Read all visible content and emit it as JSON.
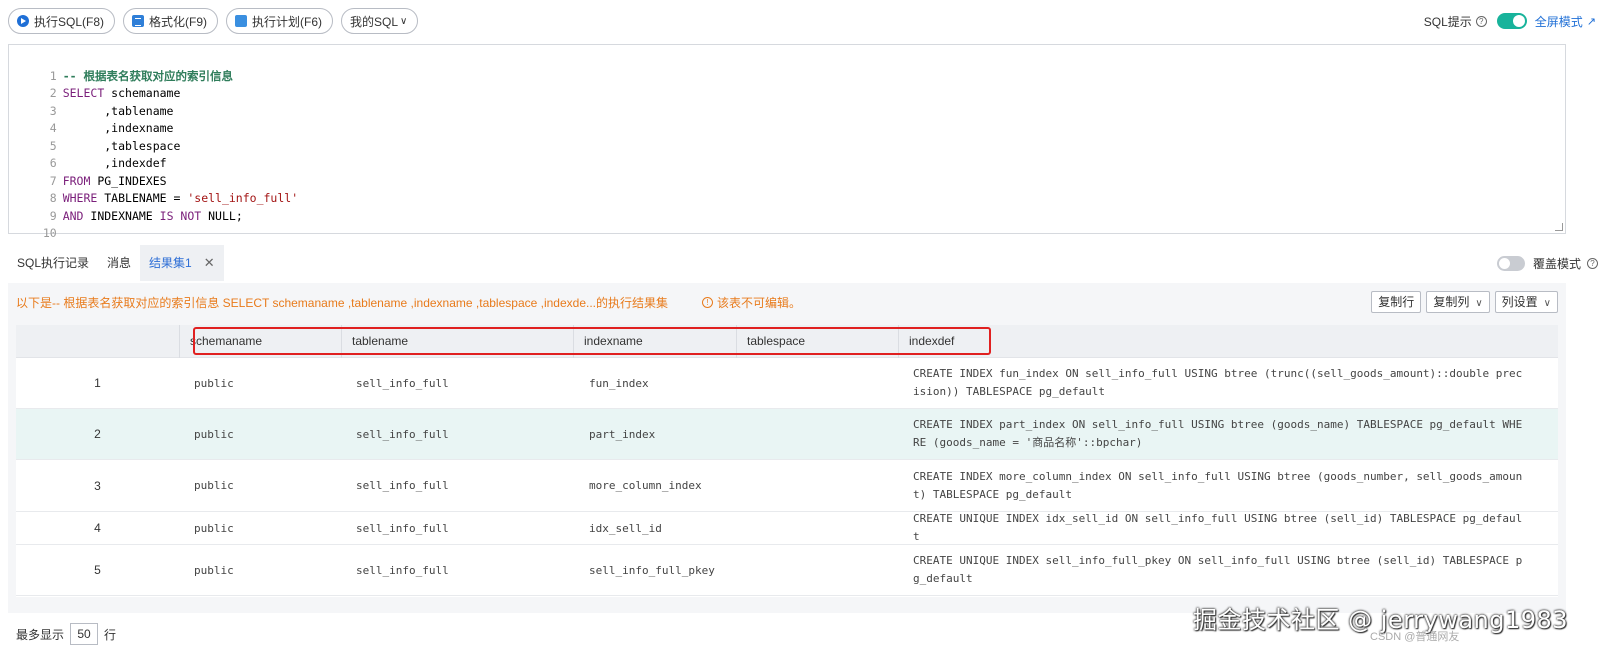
{
  "toolbar": {
    "run_label": "执行SQL(F8)",
    "format_label": "格式化(F9)",
    "plan_label": "执行计划(F6)",
    "mysql_label": "我的SQL",
    "sql_hint_label": "SQL提示",
    "sql_hint_enabled": true,
    "fullscreen_label": "全屏模式"
  },
  "editor": {
    "lines": [
      {
        "num": "1",
        "text": "-- 根据表名获取对应的索引信息"
      },
      {
        "num": "2",
        "kw": "SELECT",
        "text": " schemaname"
      },
      {
        "num": "3",
        "text": "      ,tablename"
      },
      {
        "num": "4",
        "text": "      ,indexname"
      },
      {
        "num": "5",
        "text": "      ,tablespace"
      },
      {
        "num": "6",
        "text": "      ,indexdef"
      },
      {
        "num": "7",
        "kw": "FROM",
        "text": " PG_INDEXES"
      },
      {
        "num": "8",
        "kw": "WHERE",
        "text": " TABLENAME = ",
        "str": "'sell_info_full'"
      },
      {
        "num": "9",
        "kw": "AND",
        "text": " INDEXNAME ",
        "kw2": "IS NOT",
        "text2": " NULL;"
      },
      {
        "num": "10",
        "text": ""
      }
    ]
  },
  "result_tabs": {
    "tabs": [
      "SQL执行记录",
      "消息",
      "结果集1"
    ],
    "overlay_label": "覆盖模式",
    "overlay_enabled": false
  },
  "result": {
    "info_text": "以下是-- 根据表名获取对应的索引信息 SELECT schemaname ,tablename ,indexname ,tablespace ,indexde...的执行结果集",
    "readonly_text": "该表不可编辑。",
    "copy_row_label": "复制行",
    "copy_col_label": "复制列",
    "col_settings_label": "列设置",
    "columns": [
      "schemaname",
      "tablename",
      "indexname",
      "tablespace",
      "indexdef"
    ],
    "rows": [
      {
        "n": "1",
        "schemaname": "public",
        "tablename": "sell_info_full",
        "indexname": "fun_index",
        "tablespace": "",
        "indexdef": "CREATE INDEX fun_index ON sell_info_full USING btree (trunc((sell_goods_amount)::double precision)) TABLESPACE pg_default"
      },
      {
        "n": "2",
        "schemaname": "public",
        "tablename": "sell_info_full",
        "indexname": "part_index",
        "tablespace": "",
        "indexdef": "CREATE INDEX part_index ON sell_info_full USING btree (goods_name) TABLESPACE pg_default WHERE (goods_name = '商品名称'::bpchar)"
      },
      {
        "n": "3",
        "schemaname": "public",
        "tablename": "sell_info_full",
        "indexname": "more_column_index",
        "tablespace": "",
        "indexdef": "CREATE INDEX more_column_index ON sell_info_full USING btree (goods_number, sell_goods_amount) TABLESPACE pg_default"
      },
      {
        "n": "4",
        "schemaname": "public",
        "tablename": "sell_info_full",
        "indexname": "idx_sell_id",
        "tablespace": "",
        "indexdef": "CREATE UNIQUE INDEX idx_sell_id ON sell_info_full USING btree (sell_id) TABLESPACE pg_default"
      },
      {
        "n": "5",
        "schemaname": "public",
        "tablename": "sell_info_full",
        "indexname": "sell_info_full_pkey",
        "tablespace": "",
        "indexdef": "CREATE UNIQUE INDEX sell_info_full_pkey ON sell_info_full USING btree (sell_id) TABLESPACE pg_default"
      }
    ]
  },
  "footer": {
    "prefix": "最多显示",
    "max_rows": "50",
    "suffix": "行"
  },
  "watermark": {
    "main": "掘金技术社区 @ jerrywang1983",
    "sub": "CSDN @普通网友"
  },
  "colors": {
    "accent": "#1f6fd6",
    "switch_on": "#18b39b",
    "warning": "#e87b1c",
    "highlight": "#e02020",
    "alt_row": "#e9f5f4"
  }
}
